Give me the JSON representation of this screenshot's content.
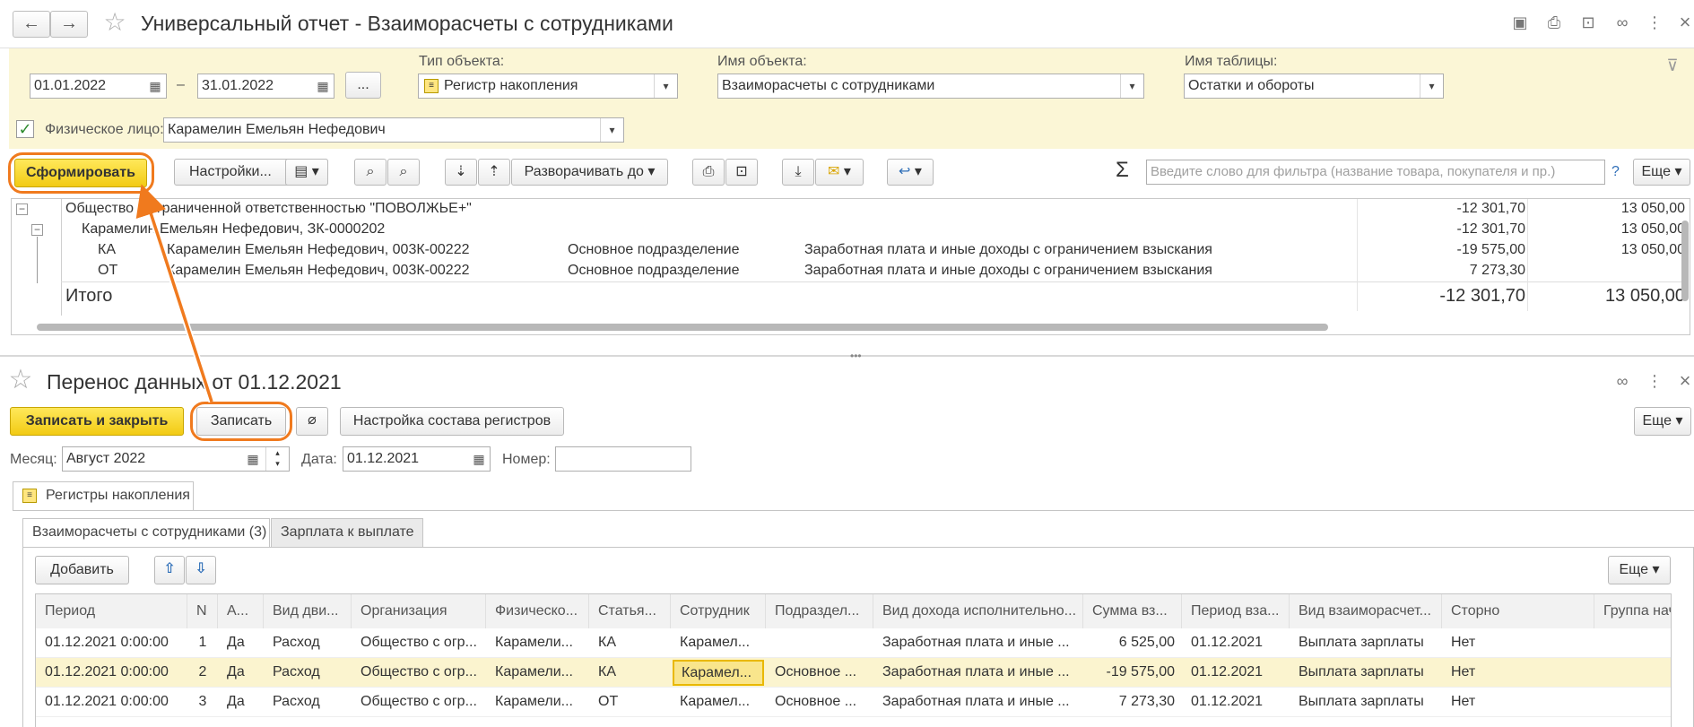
{
  "report": {
    "title": "Универсальный отчет - Взаиморасчеты с сотрудниками",
    "date_from": "01.01.2022",
    "date_sep": "–",
    "date_to": "31.01.2022",
    "more_dots": "...",
    "object_type_label": "Тип объекта:",
    "object_type_value": "Регистр накопления",
    "object_name_label": "Имя объекта:",
    "object_name_value": "Взаиморасчеты с сотрудниками",
    "table_name_label": "Имя таблицы:",
    "table_name_value": "Остатки и обороты",
    "person_label": "Физическое лицо:",
    "person_value": "Карамелин Емельян Нефедович",
    "toolbar": {
      "generate": "Сформировать",
      "settings": "Настройки...",
      "expand_to": "Разворачивать до",
      "filter_placeholder": "Введите слово для фильтра (название товара, покупателя и пр.)",
      "help": "?",
      "more": "Еще"
    },
    "rows": [
      {
        "name": "Общество с ограниченной ответственностью \"ПОВОЛЖЬЕ+\"",
        "v1": "-12 301,70",
        "v2": "13 050,00"
      },
      {
        "name": "Карамелин Емельян Нефедович, ЗК-0000202",
        "v1": "-12 301,70",
        "v2": "13 050,00"
      },
      {
        "code": "КА",
        "name": "Карамелин Емельян Нефедович, 003К-00222",
        "dept": "Основное подразделение",
        "income": "Заработная плата и иные доходы с ограничением взыскания",
        "v1": "-19 575,00",
        "v2": "13 050,00"
      },
      {
        "code": "ОТ",
        "name": "Карамелин Емельян Нефедович, 003К-00222",
        "dept": "Основное подразделение",
        "income": "Заработная плата и иные доходы с ограничением взыскания",
        "v1": "7 273,30",
        "v2": ""
      }
    ],
    "total_label": "Итого",
    "total_v1": "-12 301,70",
    "total_v2": "13 050,00"
  },
  "doc": {
    "title": "Перенос данных  от 01.12.2021",
    "save_close": "Записать и закрыть",
    "save": "Записать",
    "register_setup": "Настройка состава регистров",
    "more": "Еще",
    "month_label": "Месяц:",
    "month_value": "Август 2022",
    "date_label": "Дата:",
    "date_value": "01.12.2021",
    "number_label": "Номер:",
    "number_value": "",
    "outer_tab": "Регистры накопления",
    "tabs": [
      "Взаиморасчеты с сотрудниками (3)",
      "Зарплата к выплате"
    ],
    "add": "Добавить",
    "table_more": "Еще",
    "columns": [
      "Период",
      "N",
      "А...",
      "Вид дви...",
      "Организация",
      "Физическо...",
      "Статья...",
      "Сотрудник",
      "Подраздел...",
      "Вид дохода исполнительно...",
      "Сумма вз...",
      "Период вза...",
      "Вид взаиморасчет...",
      "Сторно",
      "Группа нач"
    ],
    "rows": [
      [
        "01.12.2021 0:00:00",
        "1",
        "Да",
        "Расход",
        "Общество с огр...",
        "Карамели...",
        "КА",
        "Карамел...",
        "",
        "Заработная плата и иные ...",
        "6 525,00",
        "01.12.2021",
        "Выплата зарплаты",
        "Нет",
        ""
      ],
      [
        "01.12.2021 0:00:00",
        "2",
        "Да",
        "Расход",
        "Общество с огр...",
        "Карамели...",
        "КА",
        "Карамел...",
        "Основное ...",
        "Заработная плата и иные ...",
        "-19 575,00",
        "01.12.2021",
        "Выплата зарплаты",
        "Нет",
        ""
      ],
      [
        "01.12.2021 0:00:00",
        "3",
        "Да",
        "Расход",
        "Общество с огр...",
        "Карамели...",
        "ОТ",
        "Карамел...",
        "Основное ...",
        "Заработная плата и иные ...",
        "7 273,30",
        "01.12.2021",
        "Выплата зарплаты",
        "Нет",
        ""
      ]
    ]
  },
  "icons": {
    "back": "←",
    "forward": "→",
    "star": "☆",
    "calendar": "▦",
    "dropdown": "▾",
    "check": "✓",
    "search": "⚲",
    "sigma": "Σ",
    "up": "🡅",
    "down": "🡇",
    "more_vert": "⋮",
    "close": "×",
    "link": "🔗",
    "clip": "📎",
    "printer": "⎙",
    "filter": "⊽"
  },
  "colors": {
    "accent_yellow": "#f2cb14",
    "filter_bg": "#fbf6d6",
    "highlight_row": "#fbf4cf",
    "orange_annotation": "#f07a1e"
  }
}
